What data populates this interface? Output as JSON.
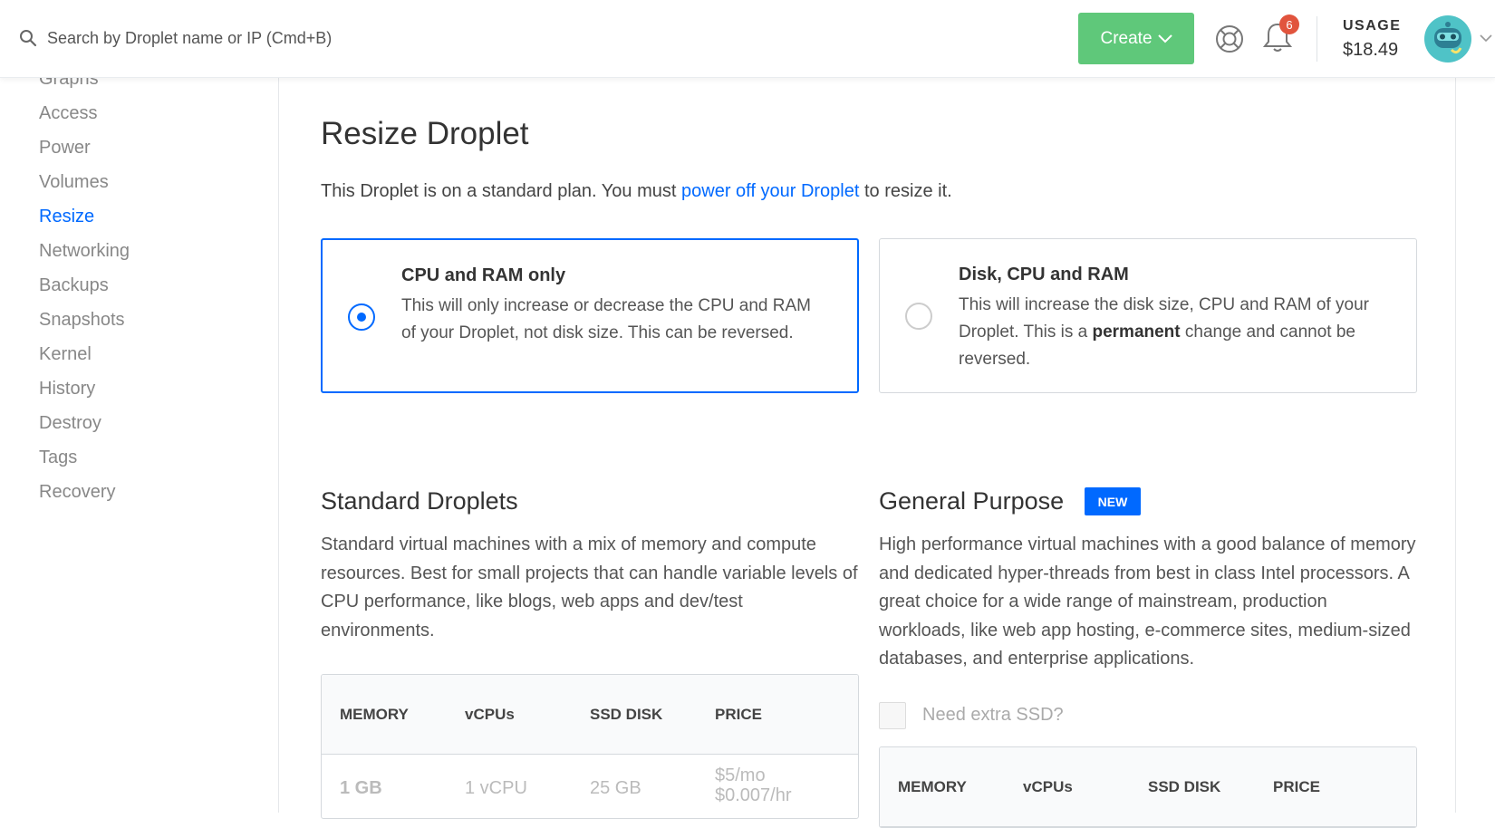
{
  "topbar": {
    "search_placeholder": "Search by Droplet name or IP (Cmd+B)",
    "create_label": "Create",
    "notification_count": "6",
    "usage_label": "USAGE",
    "usage_value": "$18.49"
  },
  "sidebar": {
    "items": [
      {
        "label": "Graphs"
      },
      {
        "label": "Access"
      },
      {
        "label": "Power"
      },
      {
        "label": "Volumes"
      },
      {
        "label": "Resize",
        "active": true
      },
      {
        "label": "Networking"
      },
      {
        "label": "Backups"
      },
      {
        "label": "Snapshots"
      },
      {
        "label": "Kernel"
      },
      {
        "label": "History"
      },
      {
        "label": "Destroy"
      },
      {
        "label": "Tags"
      },
      {
        "label": "Recovery"
      }
    ]
  },
  "main": {
    "title": "Resize Droplet",
    "intro_before": "This Droplet is on a standard plan. You must ",
    "intro_link": "power off your Droplet",
    "intro_after": " to resize it.",
    "options": [
      {
        "title": "CPU and RAM only",
        "desc": "This will only increase or decrease the CPU and RAM of your Droplet, not disk size. This can be reversed.",
        "selected": true
      },
      {
        "title": "Disk, CPU and RAM",
        "desc_before": "This will increase the disk size, CPU and RAM of your Droplet. This is a ",
        "desc_bold": "permanent",
        "desc_after": " change and cannot be reversed.",
        "selected": false
      }
    ],
    "standard": {
      "title": "Standard Droplets",
      "desc": "Standard virtual machines with a mix of memory and compute resources. Best for small projects that can handle variable levels of CPU performance, like blogs, web apps and dev/test environments.",
      "headers": [
        "MEMORY",
        "vCPUs",
        "SSD DISK",
        "PRICE"
      ],
      "rows": [
        {
          "memory": "1 GB",
          "vcpus": "1 vCPU",
          "disk": "25 GB",
          "price_mo": "$5/mo",
          "price_hr": "$0.007/hr"
        }
      ]
    },
    "general": {
      "title": "General Purpose",
      "badge": "NEW",
      "desc": "High performance virtual machines with a good balance of memory and dedicated hyper-threads from best in class Intel processors. A great choice for a wide range of mainstream, production workloads, like web app hosting, e-commerce sites, medium-sized databases, and enterprise applications.",
      "extra_ssd_label": "Need extra SSD?",
      "headers": [
        "MEMORY",
        "vCPUs",
        "SSD DISK",
        "PRICE"
      ]
    }
  },
  "colors": {
    "accent": "#0069ff",
    "create_green": "#5fc87a",
    "badge_red": "#e1543d"
  }
}
